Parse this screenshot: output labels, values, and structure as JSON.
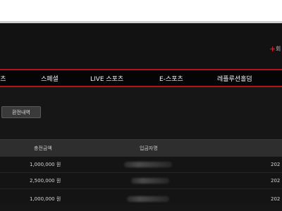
{
  "header": {
    "plus_symbol": "+",
    "plus_label": "회"
  },
  "nav": {
    "items": [
      {
        "label": "포츠"
      },
      {
        "label": "스페셜"
      },
      {
        "label": "LIVE 스포츠"
      },
      {
        "label": "E-스포츠"
      },
      {
        "label": "레플루션홀덤"
      }
    ]
  },
  "toolbar": {
    "button_label": "환전내역"
  },
  "table": {
    "headers": {
      "amount": "충전금액",
      "account": "입금자명"
    },
    "rows": [
      {
        "amount": "1,000,000 원",
        "date": "202"
      },
      {
        "amount": "2,500,000 원",
        "date": "202"
      },
      {
        "amount": "1,000,000 원",
        "date": "202"
      }
    ]
  },
  "colors": {
    "accent": "#b3121b",
    "plus": "#e2141c",
    "background": "#0c0c0c"
  }
}
